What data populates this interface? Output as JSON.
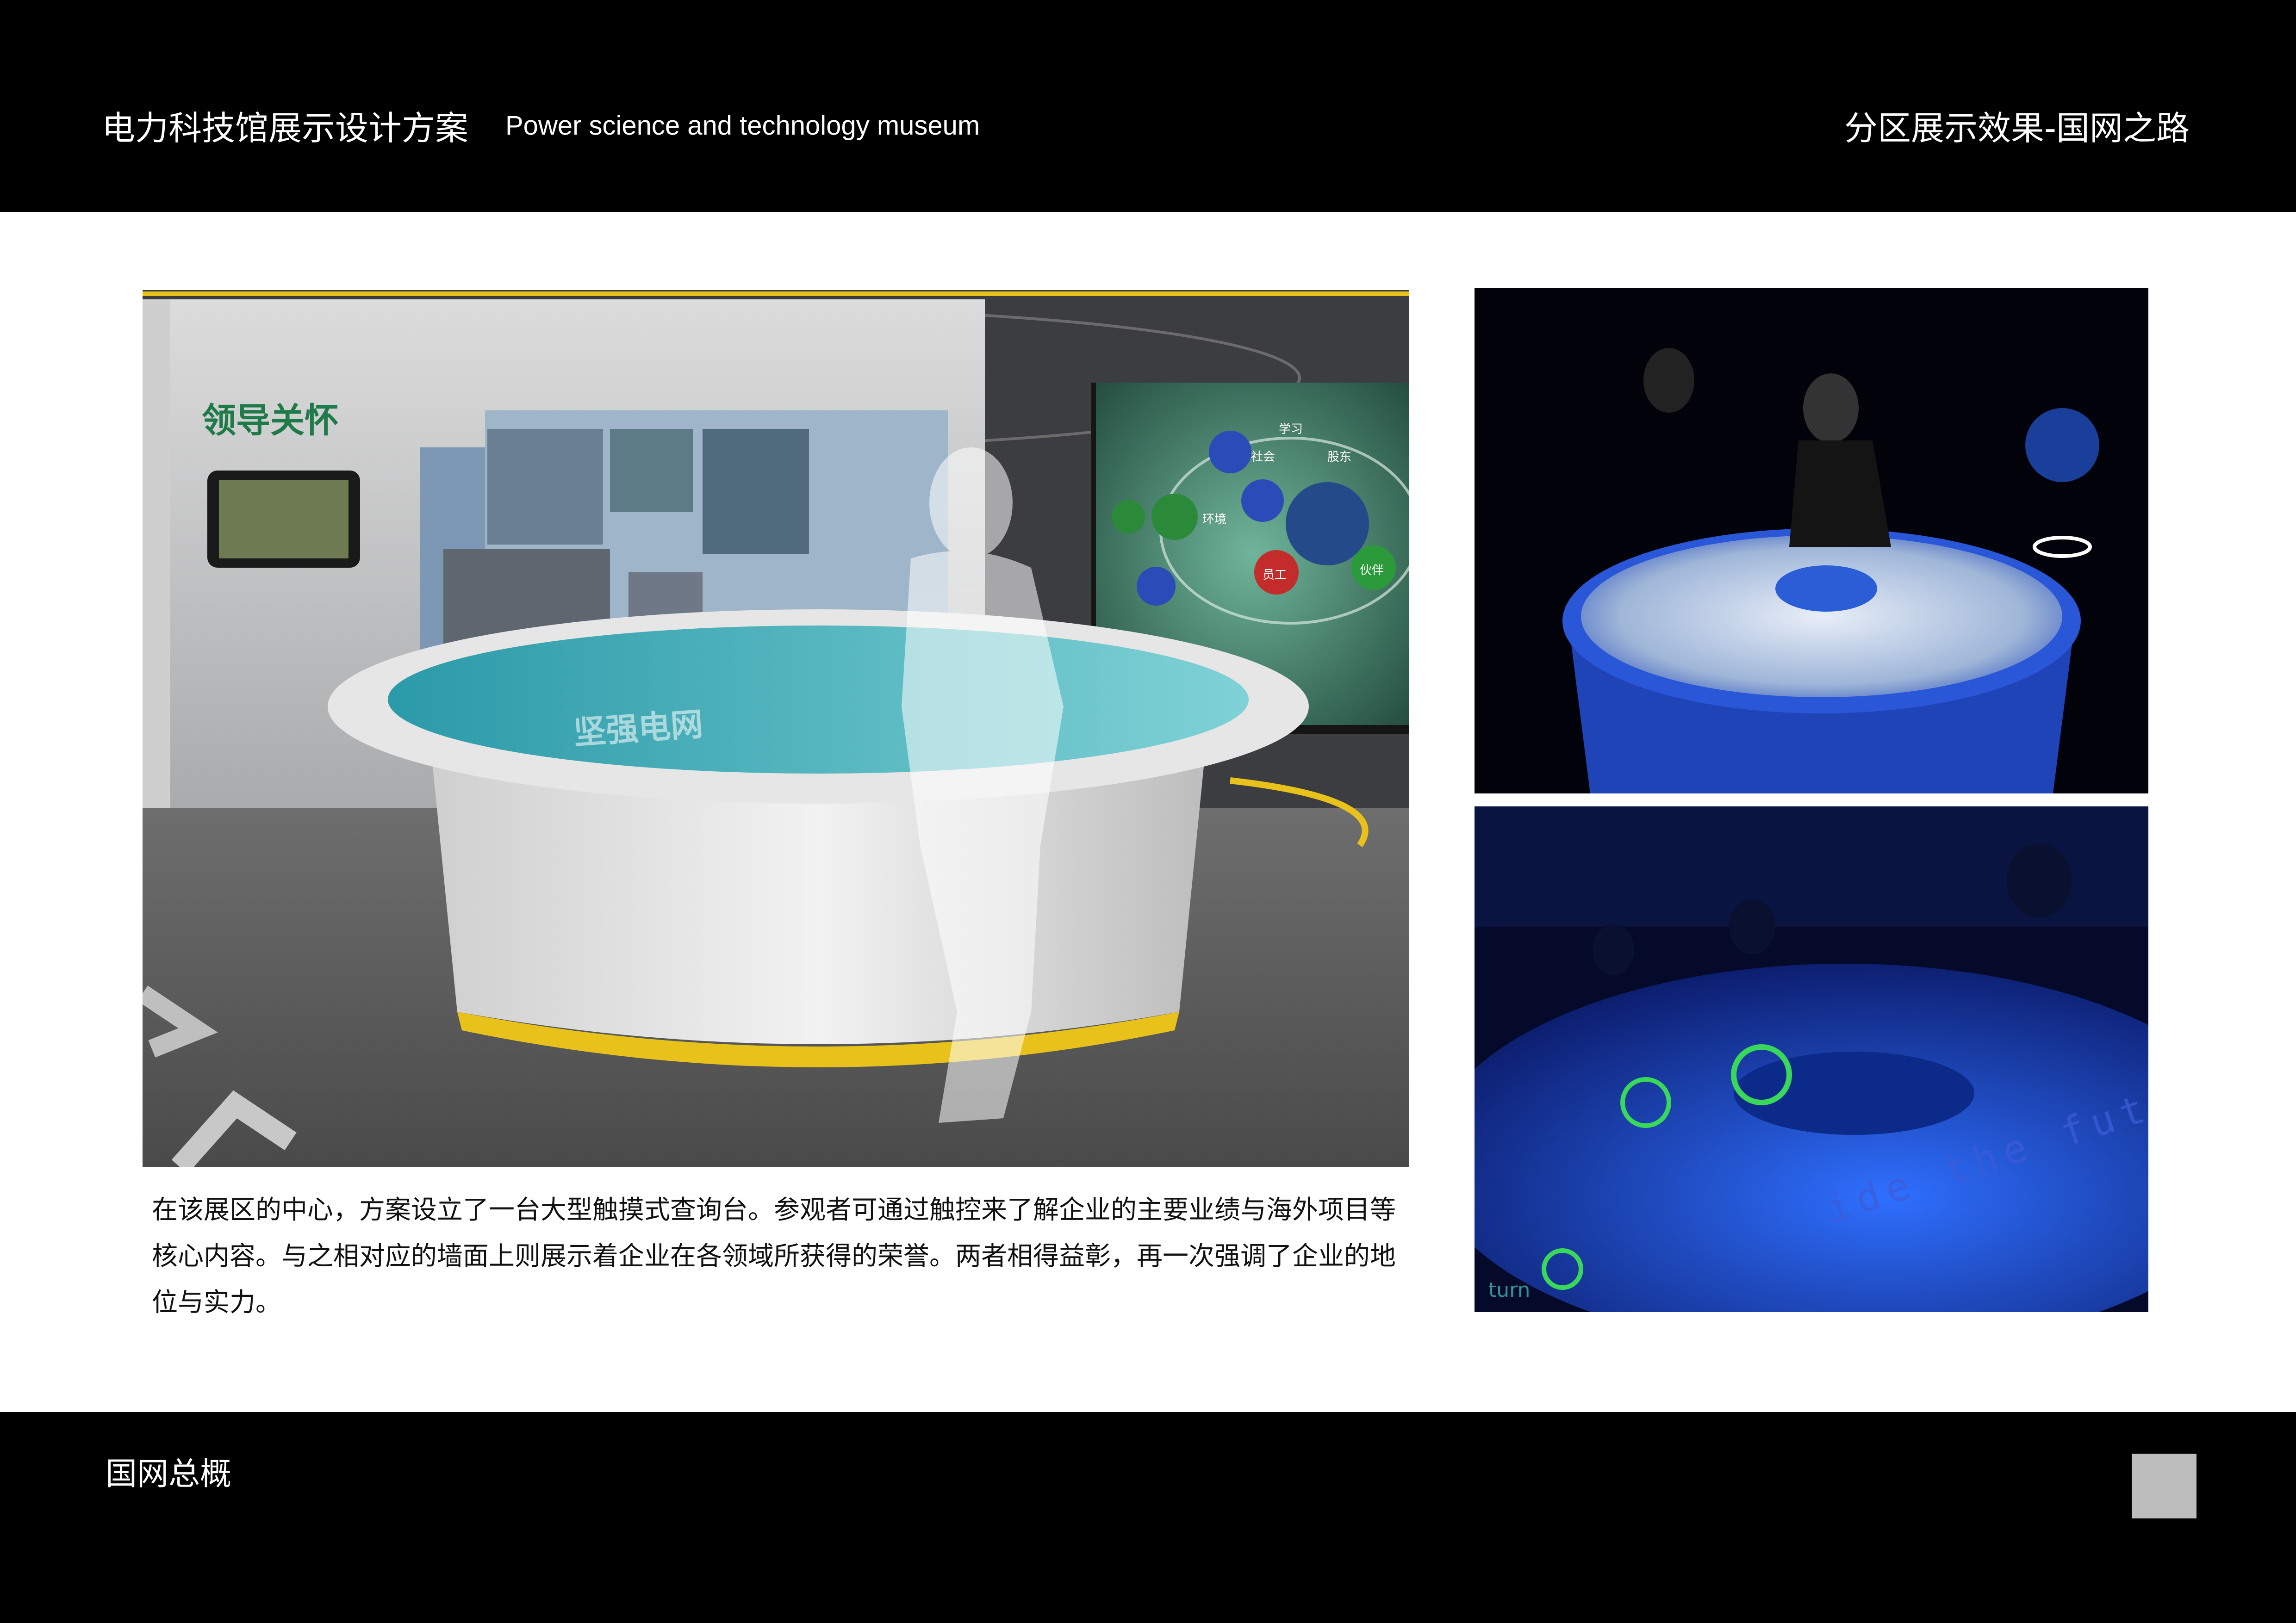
{
  "header": {
    "title": "电力科技馆展示设计方案",
    "subtitle": "Power science and technology museum",
    "section": "分区展示效果-国网之路"
  },
  "main_render": {
    "wall_title": "领导关怀",
    "disc_label": "坚强电网",
    "nodes": [
      "学习",
      "社会",
      "股东",
      "环境",
      "员工",
      "伙伴"
    ]
  },
  "photos": {
    "bottom_text": "ide the future",
    "bottom_corner_text": "turn"
  },
  "description": "在该展区的中心，方案设立了一台大型触摸式查询台。参观者可通过触控来了解企业的主要业绩与海外项目等核心内容。与之相对应的墙面上则展示着企业在各领域所获得的荣誉。两者相得益彰，再一次强调了企业的地位与实力。",
  "footer": {
    "label": "国网总概"
  }
}
